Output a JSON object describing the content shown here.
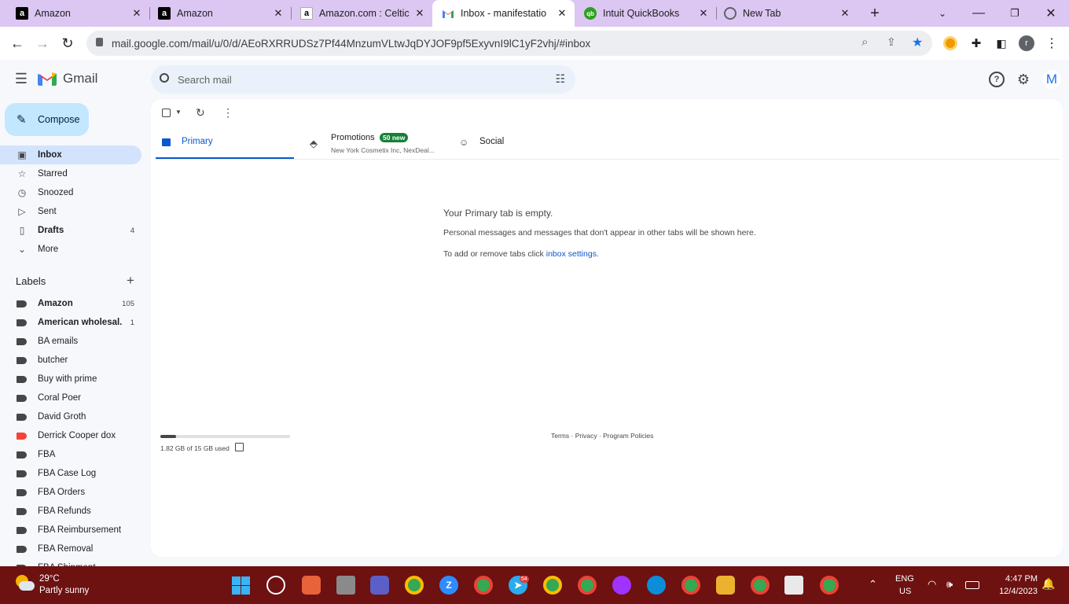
{
  "browser": {
    "tabs": [
      {
        "title": "Amazon",
        "icon": "amazon-icon"
      },
      {
        "title": "Amazon",
        "icon": "amazon-icon"
      },
      {
        "title": "Amazon.com : Celtic",
        "icon": "amazon-icon"
      },
      {
        "title": "Inbox - manifestatio",
        "icon": "gmail-icon",
        "active": true
      },
      {
        "title": "Intuit QuickBooks",
        "icon": "quickbooks-icon"
      },
      {
        "title": "New Tab",
        "icon": "chrome-icon"
      }
    ],
    "url": "mail.google.com/mail/u/0/d/AEoRXRRUDSz7Pf44MnzumVLtwJqDYJOF9pf5ExyvnI9lC1yF2vhj/#inbox",
    "profile_initial": "r"
  },
  "gmail": {
    "logo_text": "Gmail",
    "search_placeholder": "Search mail",
    "account_initial": "M",
    "compose_label": "Compose",
    "nav": [
      {
        "label": "Inbox",
        "count": "",
        "icon": "inbox-icon",
        "bold": true,
        "selected": true
      },
      {
        "label": "Starred",
        "count": "",
        "icon": "star-icon"
      },
      {
        "label": "Snoozed",
        "count": "",
        "icon": "clock-icon"
      },
      {
        "label": "Sent",
        "count": "",
        "icon": "send-icon"
      },
      {
        "label": "Drafts",
        "count": "4",
        "icon": "draft-icon",
        "bold": true
      },
      {
        "label": "More",
        "count": "",
        "icon": "chevron-down-icon"
      }
    ],
    "labels_title": "Labels",
    "labels": [
      {
        "label": "Amazon",
        "count": "105",
        "bold": true,
        "color": "#444746"
      },
      {
        "label": "American wholesal...",
        "count": "1",
        "bold": true,
        "color": "#444746"
      },
      {
        "label": "BA emails",
        "count": "",
        "color": "#444746"
      },
      {
        "label": "butcher",
        "count": "",
        "color": "#444746"
      },
      {
        "label": "Buy with prime",
        "count": "",
        "color": "#444746"
      },
      {
        "label": "Coral Poer",
        "count": "",
        "color": "#444746"
      },
      {
        "label": "David Groth",
        "count": "",
        "color": "#444746"
      },
      {
        "label": "Derrick Cooper dox",
        "count": "",
        "color": "#f44336"
      },
      {
        "label": "FBA",
        "count": "",
        "color": "#444746"
      },
      {
        "label": "FBA Case Log",
        "count": "",
        "color": "#444746"
      },
      {
        "label": "FBA Orders",
        "count": "",
        "color": "#444746"
      },
      {
        "label": "FBA Refunds",
        "count": "",
        "color": "#444746"
      },
      {
        "label": "FBA Reimbursement",
        "count": "",
        "color": "#444746"
      },
      {
        "label": "FBA Removal",
        "count": "",
        "color": "#444746"
      },
      {
        "label": "FBA Shipment",
        "count": "",
        "color": "#444746"
      }
    ],
    "category_tabs": {
      "primary": "Primary",
      "promotions": "Promotions",
      "promotions_badge": "50 new",
      "promotions_snippet": "New York Cosmetix Inc, NexDeal...",
      "social": "Social"
    },
    "empty": {
      "title": "Your Primary tab is empty.",
      "line1": "Personal messages and messages that don't appear in other tabs will be shown here.",
      "line2_prefix": "To add or remove tabs click ",
      "line2_link": "inbox settings",
      "line2_suffix": "."
    },
    "storage": {
      "text": "1.82 GB of 15 GB used",
      "used_fraction": 0.12
    },
    "footer": {
      "terms": "Terms",
      "dot1": " · ",
      "privacy": "Privacy",
      "dot2": " · ",
      "policies": "Program Policies"
    }
  },
  "taskbar": {
    "weather_temp": "29°C",
    "weather_desc": "Partly sunny",
    "lang1": "ENG",
    "lang2": "US",
    "time": "4:47 PM",
    "date": "12/4/2023",
    "telegram_badge": "54"
  },
  "colors": {
    "accent": "#0b57d0",
    "badge": "#188038",
    "taskbar": "#6d1111"
  }
}
